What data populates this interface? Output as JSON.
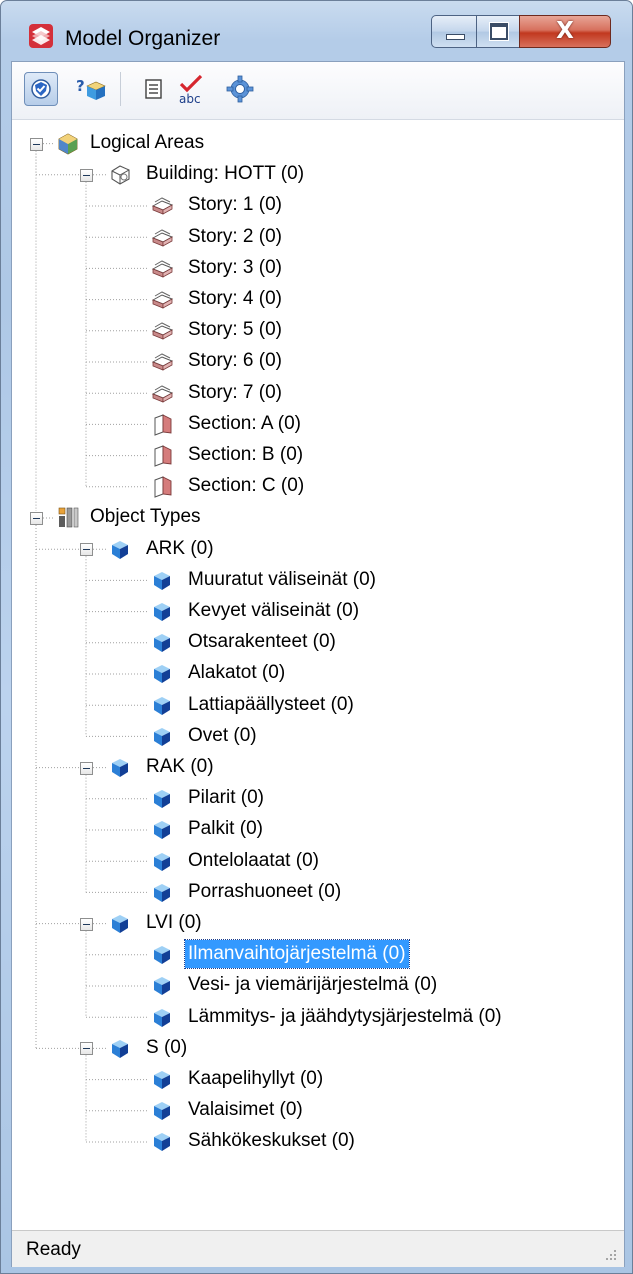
{
  "window": {
    "title": "Model Organizer",
    "close_glyph": "X"
  },
  "toolbar": {
    "buttons": [
      {
        "name": "filter",
        "icon": "shield-check-icon"
      },
      {
        "name": "help",
        "icon": "help-icon"
      },
      {
        "name": "list",
        "icon": "list-icon"
      },
      {
        "name": "spelling",
        "icon": "spell-check-icon"
      },
      {
        "name": "settings",
        "icon": "gear-icon"
      }
    ]
  },
  "tree": [
    {
      "label": "Logical Areas",
      "level": 0,
      "icon": "logical-areas-icon",
      "expanded": true
    },
    {
      "label": "Building: HOTT (0)",
      "level": 1,
      "icon": "building-icon",
      "expanded": true
    },
    {
      "label": "Story: 1 (0)",
      "level": 2,
      "icon": "story-icon"
    },
    {
      "label": "Story: 2 (0)",
      "level": 2,
      "icon": "story-icon"
    },
    {
      "label": "Story: 3 (0)",
      "level": 2,
      "icon": "story-icon"
    },
    {
      "label": "Story: 4 (0)",
      "level": 2,
      "icon": "story-icon"
    },
    {
      "label": "Story: 5 (0)",
      "level": 2,
      "icon": "story-icon"
    },
    {
      "label": "Story: 6 (0)",
      "level": 2,
      "icon": "story-icon"
    },
    {
      "label": "Story: 7 (0)",
      "level": 2,
      "icon": "story-icon"
    },
    {
      "label": "Section: A (0)",
      "level": 2,
      "icon": "section-icon"
    },
    {
      "label": "Section: B (0)",
      "level": 2,
      "icon": "section-icon"
    },
    {
      "label": "Section: C (0)",
      "level": 2,
      "icon": "section-icon"
    },
    {
      "label": "Object Types",
      "level": 0,
      "icon": "object-types-icon",
      "expanded": true
    },
    {
      "label": "ARK (0)",
      "level": 1,
      "icon": "object-type-icon",
      "expanded": true
    },
    {
      "label": "Muuratut väliseinät (0)",
      "level": 2,
      "icon": "object-type-icon"
    },
    {
      "label": "Kevyet väliseinät (0)",
      "level": 2,
      "icon": "object-type-icon"
    },
    {
      "label": "Otsarakenteet (0)",
      "level": 2,
      "icon": "object-type-icon"
    },
    {
      "label": "Alakatot (0)",
      "level": 2,
      "icon": "object-type-icon"
    },
    {
      "label": "Lattiapäällysteet (0)",
      "level": 2,
      "icon": "object-type-icon"
    },
    {
      "label": "Ovet (0)",
      "level": 2,
      "icon": "object-type-icon"
    },
    {
      "label": "RAK (0)",
      "level": 1,
      "icon": "object-type-icon",
      "expanded": true
    },
    {
      "label": "Pilarit (0)",
      "level": 2,
      "icon": "object-type-icon"
    },
    {
      "label": "Palkit (0)",
      "level": 2,
      "icon": "object-type-icon"
    },
    {
      "label": "Ontelolaatat (0)",
      "level": 2,
      "icon": "object-type-icon"
    },
    {
      "label": "Porrashuoneet (0)",
      "level": 2,
      "icon": "object-type-icon"
    },
    {
      "label": "LVI (0)",
      "level": 1,
      "icon": "object-type-icon",
      "expanded": true
    },
    {
      "label": "Ilmanvaihtojärjestelmä (0)",
      "level": 2,
      "icon": "object-type-icon",
      "selected": true
    },
    {
      "label": "Vesi- ja viemärijärjestelmä (0)",
      "level": 2,
      "icon": "object-type-icon"
    },
    {
      "label": "Lämmitys- ja jäähdytysjärjestelmä (0)",
      "level": 2,
      "icon": "object-type-icon"
    },
    {
      "label": "S (0)",
      "level": 1,
      "icon": "object-type-icon",
      "expanded": true
    },
    {
      "label": "Kaapelihyllyt (0)",
      "level": 2,
      "icon": "object-type-icon"
    },
    {
      "label": "Valaisimet (0)",
      "level": 2,
      "icon": "object-type-icon"
    },
    {
      "label": "Sähkökeskukset (0)",
      "level": 2,
      "icon": "object-type-icon"
    }
  ],
  "status": {
    "text": "Ready"
  },
  "colors": {
    "selection": "#3399ff",
    "window_frame": "#b4cce8"
  }
}
